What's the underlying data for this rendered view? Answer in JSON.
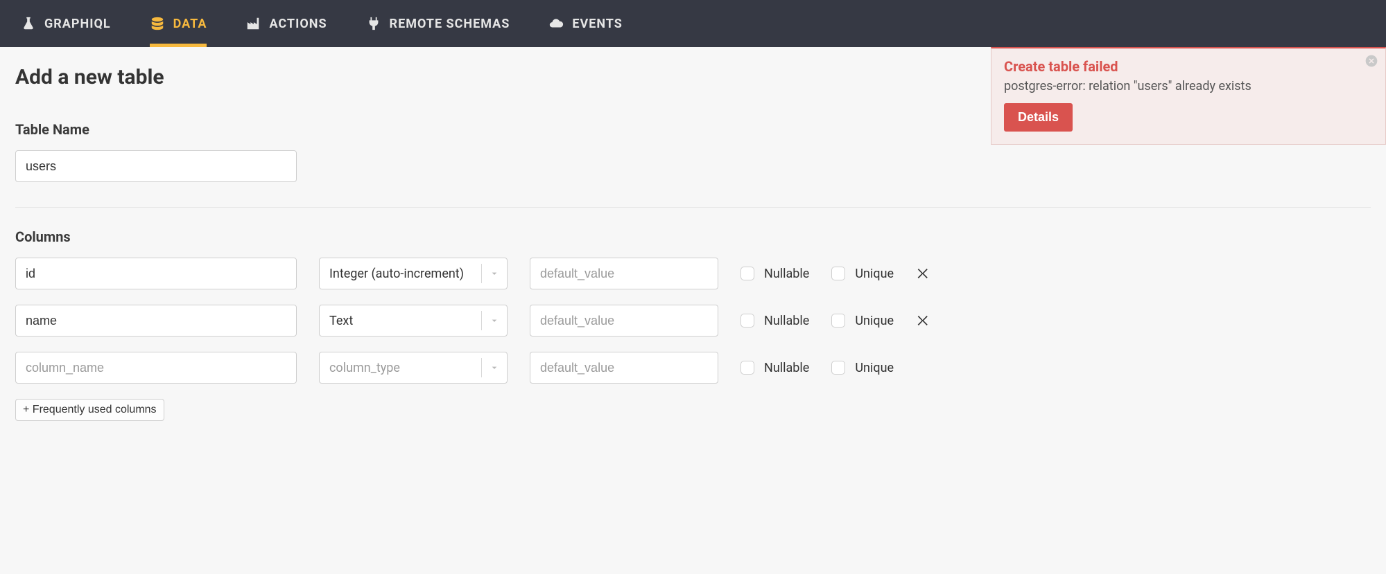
{
  "nav": {
    "items": [
      {
        "label": "GRAPHIQL",
        "icon": "flask"
      },
      {
        "label": "DATA",
        "icon": "database",
        "active": true
      },
      {
        "label": "ACTIONS",
        "icon": "factory"
      },
      {
        "label": "REMOTE SCHEMAS",
        "icon": "plug"
      },
      {
        "label": "EVENTS",
        "icon": "cloud"
      }
    ]
  },
  "toast": {
    "title": "Create table failed",
    "body": "postgres-error: relation \"users\" already exists",
    "button": "Details"
  },
  "page": {
    "title": "Add a new table",
    "table_name_label": "Table Name",
    "table_name_value": "users",
    "columns_label": "Columns",
    "frequently_used_label": "+ Frequently used columns",
    "nullable_label": "Nullable",
    "unique_label": "Unique",
    "column_name_ph": "column_name",
    "column_type_ph": "column_type",
    "default_value_ph": "default_value"
  },
  "columns": [
    {
      "name": "id",
      "type": "Integer (auto-increment)",
      "default": "",
      "nullable": false,
      "unique": false,
      "removable": true
    },
    {
      "name": "name",
      "type": "Text",
      "default": "",
      "nullable": false,
      "unique": false,
      "removable": true
    },
    {
      "name": "",
      "type": "",
      "default": "",
      "nullable": false,
      "unique": false,
      "removable": false
    }
  ]
}
